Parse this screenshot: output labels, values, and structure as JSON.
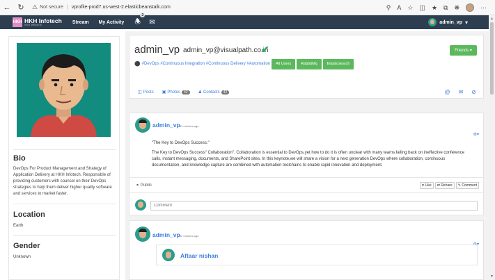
{
  "browser": {
    "not_secure": "Not secure",
    "url": "vprofile-prod7.us-west-2.elasticbeanstalk.com"
  },
  "navbar": {
    "logo_text": "HKH",
    "brand": "HKH Infotech",
    "brand_tagline": "VISIT WEBSITE",
    "links": [
      "Stream",
      "My Activity"
    ],
    "notification_count": "2",
    "user": "admin_vp"
  },
  "profile": {
    "username": "admin_vp",
    "email": "admin_vp@visualpath.co.in",
    "friends_label": "Friends",
    "hashtags": "#DevOps #Continuous Integration #Continuous Delivery #Automation",
    "skills": [
      "All Users",
      "RabbitMq",
      "Elasticsearch"
    ],
    "tabs": [
      {
        "label": "Posts"
      },
      {
        "label": "Photos",
        "count": "42"
      },
      {
        "label": "Contacts",
        "count": "42"
      }
    ]
  },
  "sidebar": {
    "bio_title": "Bio",
    "bio_text": "DevOps For Product Management and Strategy of Application Delivery at HKH Infotech. Responsible of providing customers with counsel on their DevOps strategies to help them deliver higher quality software and services to market faster.",
    "location_title": "Location",
    "location_value": "Earth",
    "gender_title": "Gender",
    "gender_value": "Unknown"
  },
  "posts": [
    {
      "author": "admin_vp",
      "time": "42 minutes ago",
      "title": "\"The Key to DevOps Success.\"",
      "body": "The Key to DevOps Success\" Collaboration\". Collaboration is essential to DevOps,yet how to do it is often unclear with many teams falling back on ineffective conference calls, instant messaging, documents, and SharePoint sites. In this keynote,we will share a vision for a next generation DevOps where collaboration, continuous documentation, and knowledge capture are combined with automation toolchains to enable rapid innovation and deployment.",
      "privacy": "Public",
      "actions": [
        "Like",
        "Rehare",
        "Comment"
      ],
      "comment_placeholder": "Comment"
    },
    {
      "author": "admin_vp",
      "time": "42 minutes ago",
      "nested_author": "Aftaar nishan"
    }
  ],
  "colors": {
    "navbar": "#2c3e50",
    "link": "#3b7ddd",
    "success": "#5cb85c",
    "avatar_bg": "#128c7e"
  }
}
